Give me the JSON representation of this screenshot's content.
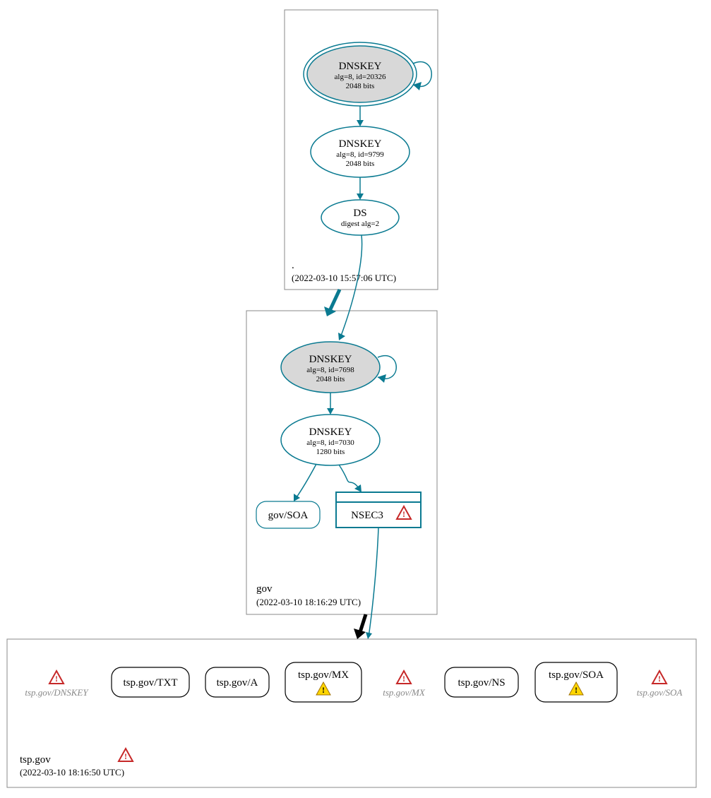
{
  "root_zone": {
    "label": ".",
    "timestamp": "(2022-03-10 15:57:06 UTC)",
    "ksk": {
      "title": "DNSKEY",
      "line1": "alg=8, id=20326",
      "line2": "2048 bits"
    },
    "zsk": {
      "title": "DNSKEY",
      "line1": "alg=8, id=9799",
      "line2": "2048 bits"
    },
    "ds": {
      "title": "DS",
      "line1": "digest alg=2"
    }
  },
  "gov_zone": {
    "label": "gov",
    "timestamp": "(2022-03-10 18:16:29 UTC)",
    "ksk": {
      "title": "DNSKEY",
      "line1": "alg=8, id=7698",
      "line2": "2048 bits"
    },
    "zsk": {
      "title": "DNSKEY",
      "line1": "alg=8, id=7030",
      "line2": "1280 bits"
    },
    "soa": "gov/SOA",
    "nsec": "NSEC3"
  },
  "tsp_zone": {
    "label": "tsp.gov",
    "timestamp": "(2022-03-10 18:16:50 UTC)",
    "dnskey_grey": "tsp.gov/DNSKEY",
    "txt": "tsp.gov/TXT",
    "a": "tsp.gov/A",
    "mx": "tsp.gov/MX",
    "mx_grey": "tsp.gov/MX",
    "ns": "tsp.gov/NS",
    "soa": "tsp.gov/SOA",
    "soa_grey": "tsp.gov/SOA"
  },
  "icons": {
    "error": "error-icon",
    "warn": "warn-icon"
  }
}
